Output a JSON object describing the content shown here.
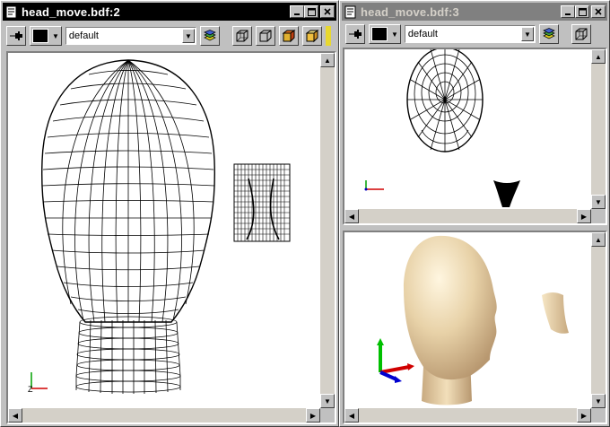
{
  "windows": [
    {
      "title": "head_move.bdf:2",
      "active": true
    },
    {
      "title": "head_move.bdf:3",
      "active": false
    }
  ],
  "toolbar": {
    "layer": "default"
  },
  "icons": {
    "pin": "pushpin-icon",
    "color": "color-swatch-icon",
    "layers": "layers-icon",
    "cube": "cube-view-icon"
  },
  "colors": {
    "titlebar_active": "#000000",
    "titlebar_inactive": "#808080",
    "shaded_model": "#e8d2a8"
  }
}
